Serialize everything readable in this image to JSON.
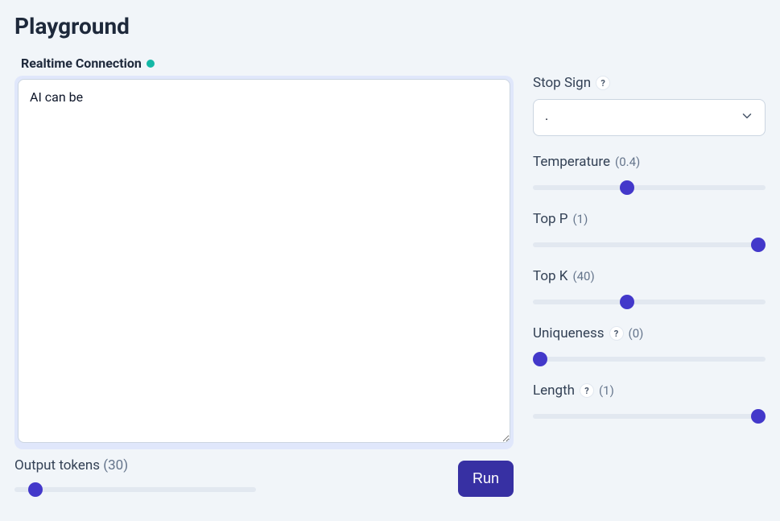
{
  "page": {
    "title": "Playground"
  },
  "connection": {
    "label": "Realtime Connection",
    "status_color": "#14b8a6"
  },
  "prompt": {
    "value": "AI can be"
  },
  "output_tokens": {
    "label": "Output tokens",
    "value": 30,
    "min": 0,
    "max": 500
  },
  "run": {
    "label": "Run"
  },
  "params": {
    "stop_sign": {
      "label": "Stop Sign",
      "help": "?",
      "selected": "."
    },
    "temperature": {
      "label": "Temperature",
      "value": 0.4,
      "min": 0,
      "max": 1
    },
    "top_p": {
      "label": "Top P",
      "value": 1,
      "min": 0,
      "max": 1
    },
    "top_k": {
      "label": "Top K",
      "value": 40,
      "min": 0,
      "max": 100
    },
    "uniqueness": {
      "label": "Uniqueness",
      "help": "?",
      "value": 0,
      "min": 0,
      "max": 1
    },
    "length": {
      "label": "Length",
      "help": "?",
      "value": 1,
      "min": 0,
      "max": 1
    }
  }
}
